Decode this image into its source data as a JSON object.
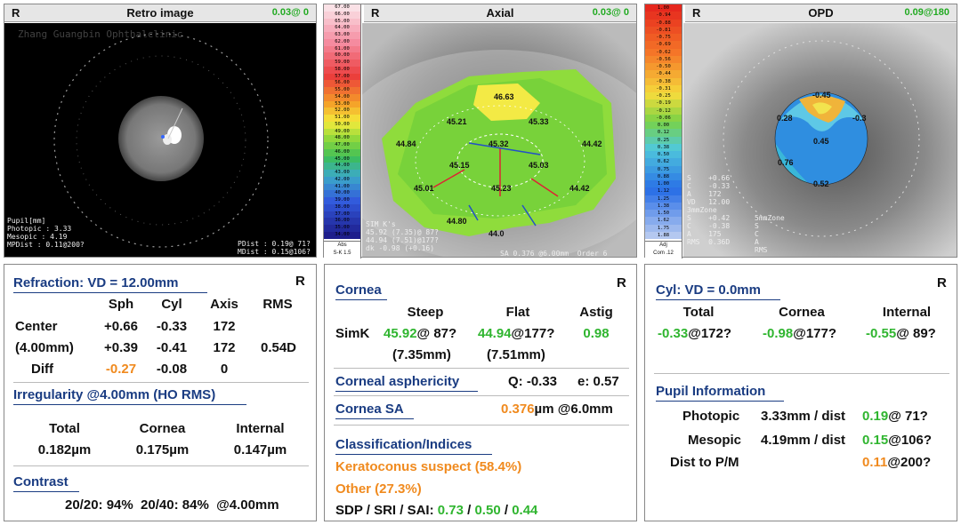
{
  "retro": {
    "eye": "R",
    "title": "Retro image",
    "value": "0.03@ 0",
    "info_left": "Pupil[mm]\nPhotopic : 3.33\nMesopic : 4.19\nMPDist : 0.11@200?",
    "info_right": "PDist : 0.19@ 71?\nMDist : 0.15@106?",
    "watermark": "Zhang Guangbin Ophthalclinic"
  },
  "axial": {
    "eye": "R",
    "title": "Axial",
    "value": "0.03@ 0",
    "scale": [
      "67.00",
      "66.00",
      "65.00",
      "64.00",
      "63.00",
      "62.00",
      "61.00",
      "60.00",
      "59.00",
      "58.00",
      "57.00",
      "56.00",
      "55.00",
      "54.00",
      "53.00",
      "52.00",
      "51.00",
      "50.00",
      "49.00",
      "48.00",
      "47.00",
      "46.00",
      "45.00",
      "44.00",
      "43.00",
      "42.00",
      "41.00",
      "40.00",
      "39.00",
      "38.00",
      "37.00",
      "36.00",
      "35.00",
      "34.00"
    ],
    "scale_foot": "Abs\nS-K 1.5",
    "values": [
      "46.63",
      "45.21",
      "45.33",
      "44.84",
      "45.32",
      "44.42",
      "45.15",
      "45.03",
      "45.01",
      "45.23",
      "44.42",
      "44.80",
      "44.0"
    ],
    "simk": "SIM K's\n45.92 (7.35)@ 87?\n44.94 (7.51)@177?\ndk -0.98 (+0.16)",
    "footer": "SA 0.376 @6.00mm  Order 6"
  },
  "opd": {
    "eye": "R",
    "title": "OPD",
    "value": "0.09@180",
    "scale": [
      "1.00",
      "-0.94",
      "-0.88",
      "-0.81",
      "-0.75",
      "-0.69",
      "-0.62",
      "-0.56",
      "-0.50",
      "-0.44",
      "-0.38",
      "-0.31",
      "-0.25",
      "-0.19",
      "-0.12",
      "-0.06",
      "0.00",
      "0.12",
      "0.25",
      "0.38",
      "0.50",
      "0.62",
      "0.75",
      "0.88",
      "1.00",
      "1.12",
      "1.25",
      "1.38",
      "1.50",
      "1.62",
      "1.75",
      "1.88"
    ],
    "scale_foot": "Adj\nCom .12",
    "values": [
      "-0.45",
      "0.28",
      "-0.3",
      "0.45",
      "0.76",
      "0.52"
    ],
    "info": "S    +0.66\nC    -0.33\nA    172\nVD   12.00\n3mmZone\nS    +0.42\nC    -0.38\nA    175\nRMS  0.36D",
    "info2": "5mmZone\nS\nC\nA\nRMS"
  },
  "refraction": {
    "title": "Refraction: VD = 12.00mm",
    "eye": "R",
    "cols": [
      "Sph",
      "Cyl",
      "Axis",
      "RMS"
    ],
    "rows": [
      {
        "label": "Center",
        "sph": "+0.66",
        "cyl": "-0.33",
        "axis": "172",
        "rms": ""
      },
      {
        "label": "(4.00mm)",
        "sph": "+0.39",
        "cyl": "-0.41",
        "axis": "172",
        "rms": "0.54D"
      },
      {
        "label": "Diff",
        "sph": "-0.27",
        "cyl": "-0.08",
        "axis": "0",
        "rms": ""
      }
    ],
    "irreg_title": "Irregularity @4.00mm (HO RMS)",
    "irreg_cols": [
      "Total",
      "Cornea",
      "Internal"
    ],
    "irreg_vals": [
      "0.182µm",
      "0.175µm",
      "0.147µm"
    ],
    "contrast_title": "Contrast",
    "contrast_val": "20/20: 94%  20/40: 84%  @4.00mm"
  },
  "cornea": {
    "title": "Cornea",
    "eye": "R",
    "cols": [
      "Steep",
      "Flat",
      "Astig"
    ],
    "simk_label": "SimK",
    "steep": "45.92",
    "steep_axis": "@ 87?",
    "flat": "44.94",
    "flat_axis": "@177?",
    "astig": "0.98",
    "steep_mm": "(7.35mm)",
    "flat_mm": "(7.51mm)",
    "asph_title": "Corneal asphericity",
    "asph_q": "Q: -0.33",
    "asph_e": "e: 0.57",
    "sa_title": "Cornea SA",
    "sa_val": "0.376",
    "sa_rest": "µm @6.0mm",
    "class_title": "Classification/Indices",
    "class1": "Keratoconus suspect (58.4%)",
    "class2": "Other (27.3%)",
    "sdp_label": "SDP / SRI / SAI: ",
    "sdp": "0.73",
    "sri": "0.50",
    "sai": "0.44"
  },
  "cyl": {
    "title": "Cyl: VD = 0.0mm",
    "eye": "R",
    "cols": [
      "Total",
      "Cornea",
      "Internal"
    ],
    "total": "-0.33",
    "total_axis": "@172?",
    "cornea": "-0.98",
    "cornea_axis": "@177?",
    "internal": "-0.55",
    "internal_axis": "@ 89?",
    "pupil_title": "Pupil Information",
    "photopic_label": "Photopic",
    "photopic_size": "3.33mm / dist",
    "photopic_val": "0.19",
    "photopic_axis": "@ 71?",
    "mesopic_label": "Mesopic",
    "mesopic_size": "4.19mm / dist",
    "mesopic_val": "0.15",
    "mesopic_axis": "@106?",
    "dist_label": "Dist to P/M",
    "dist_val": "0.11",
    "dist_axis": "@200?"
  }
}
